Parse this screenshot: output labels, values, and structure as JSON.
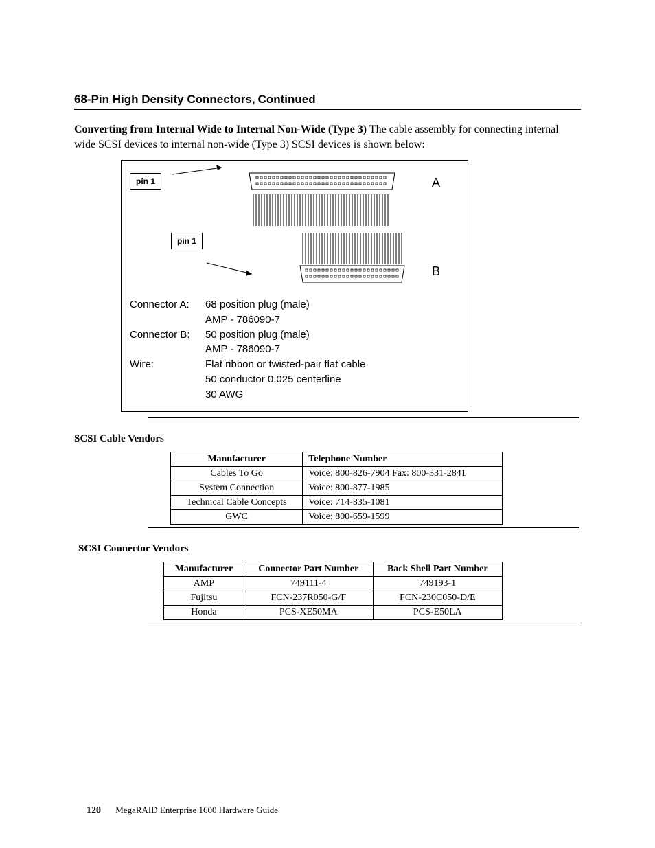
{
  "heading": {
    "title": "68-Pin High Density Connectors,",
    "continued": "Continued"
  },
  "intro": {
    "bold": "Converting from Internal Wide to Internal Non-Wide (Type 3)",
    "rest": " The cable assembly for connecting internal wide SCSI devices to internal non-wide (Type 3) SCSI devices is shown below:"
  },
  "figure": {
    "pin1": "pin 1",
    "letterA": "A",
    "letterB": "B",
    "specs": {
      "connA_label": "Connector A:",
      "connA_val1": "68 position plug (male)",
      "connA_val2": "AMP - 786090-7",
      "connB_label": "Connector B:",
      "connB_val1": "50 position plug (male)",
      "connB_val2": "AMP -  786090-7",
      "wire_label": "Wire:",
      "wire_val1": "Flat  ribbon or twisted-pair flat cable",
      "wire_val2": "50 conductor 0.025 centerline",
      "wire_val3": "30 AWG"
    }
  },
  "cable_vendors": {
    "title": "SCSI Cable Vendors",
    "headers": {
      "c0": "Manufacturer",
      "c1": "Telephone Number"
    },
    "rows": [
      {
        "c0": "Cables To Go",
        "c1": "Voice: 800-826-7904 Fax: 800-331-2841"
      },
      {
        "c0": "System Connection",
        "c1": "Voice: 800-877-1985"
      },
      {
        "c0": "Technical Cable Concepts",
        "c1": "Voice: 714-835-1081"
      },
      {
        "c0": "GWC",
        "c1": "Voice: 800-659-1599"
      }
    ]
  },
  "connector_vendors": {
    "title": "SCSI Connector Vendors",
    "headers": {
      "c0": "Manufacturer",
      "c1": "Connector Part Number",
      "c2": "Back Shell Part Number"
    },
    "rows": [
      {
        "c0": "AMP",
        "c1": "749111-4",
        "c2": "749193-1"
      },
      {
        "c0": "Fujitsu",
        "c1": "FCN-237R050-G/F",
        "c2": "FCN-230C050-D/E"
      },
      {
        "c0": "Honda",
        "c1": "PCS-XE50MA",
        "c2": "PCS-E50LA"
      }
    ]
  },
  "footer": {
    "page": "120",
    "title": "MegaRAID Enterprise 1600 Hardware Guide"
  }
}
